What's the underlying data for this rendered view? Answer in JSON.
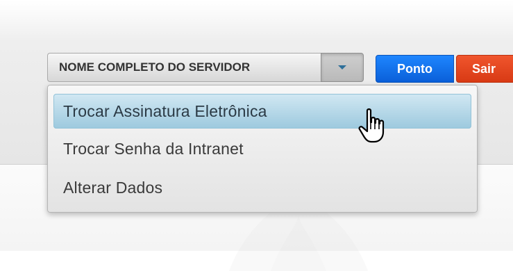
{
  "header": {
    "user_name": "NOME COMPLETO DO SERVIDOR",
    "ponto_label": "Ponto",
    "sair_label": "Sair"
  },
  "user_menu": {
    "items": [
      {
        "label": "Trocar Assinatura Eletrônica",
        "active": true
      },
      {
        "label": "Trocar Senha da Intranet",
        "active": false
      },
      {
        "label": "Alterar Dados",
        "active": false
      }
    ]
  },
  "colors": {
    "ponto": "#0a6fef",
    "sair": "#e5461f",
    "menu_active": "#aed4e6"
  },
  "icons": {
    "caret": "caret-down-icon",
    "cursor": "hand-pointer-icon"
  }
}
